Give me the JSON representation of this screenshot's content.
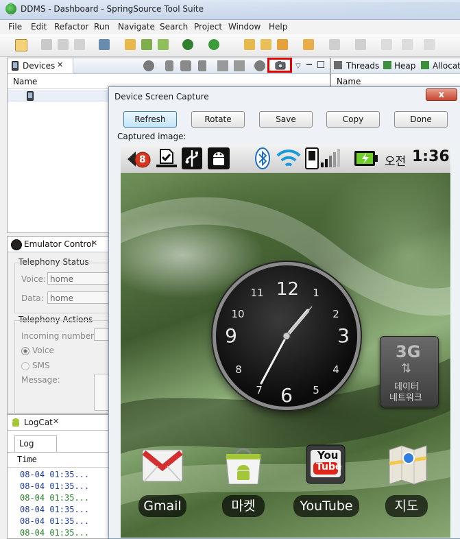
{
  "window": {
    "title": "DDMS - Dashboard - SpringSource Tool Suite"
  },
  "menu": [
    "File",
    "Edit",
    "Refactor",
    "Run",
    "Navigate",
    "Search",
    "Project",
    "Window",
    "Help"
  ],
  "devices": {
    "tab_label": "Devices",
    "tab_close": "✕",
    "name_header": "Name"
  },
  "right_panel": {
    "tabs": [
      "Threads",
      "Heap",
      "Allocatio"
    ],
    "name_header": "Name"
  },
  "emulator": {
    "tab_label": "Emulator Control",
    "tab_close": "✕",
    "telephony_status": "Telephony Status",
    "voice_label": "Voice:",
    "voice_value": "home",
    "data_label": "Data:",
    "data_value": "home",
    "telephony_actions": "Telephony Actions",
    "incoming_label": "Incoming number:",
    "radio_voice": "Voice",
    "radio_sms": "SMS",
    "message_label": "Message:"
  },
  "logcat": {
    "tab_label": "LogCat",
    "tab_close": "✕",
    "subtab": "Log",
    "time_header": "Time",
    "rows": [
      {
        "text": "08-04 01:35...",
        "color": "#1f3fa0"
      },
      {
        "text": "08-04 01:35...",
        "color": "#1f3fa0"
      },
      {
        "text": "08-04 01:35...",
        "color": "#2a7f2a"
      },
      {
        "text": "08-04 01:35...",
        "color": "#1f3fa0"
      },
      {
        "text": "08-04 01:35...",
        "color": "#1f3fa0"
      },
      {
        "text": "08-04 01:35...",
        "color": "#2a7f2a"
      }
    ]
  },
  "dialog": {
    "title": "Device Screen Capture",
    "close": "x",
    "buttons": {
      "refresh": "Refresh",
      "rotate": "Rotate",
      "save": "Save",
      "copy": "Copy",
      "done": "Done"
    },
    "captured_label": "Captured image:"
  },
  "phone": {
    "notification_count": "8",
    "ampm": "오전",
    "time": "1:36",
    "clock_numbers": [
      "12",
      "1",
      "2",
      "3",
      "4",
      "5",
      "6",
      "7",
      "8",
      "9",
      "10",
      "11"
    ],
    "widget": {
      "title": "3G",
      "line1": "데이터",
      "line2": "네트워크"
    },
    "apps": [
      "Gmail",
      "마켓",
      "YouTube",
      "지도"
    ],
    "youtube_you": "You",
    "youtube_tube": "Tube"
  },
  "colors": {
    "highlight": "#e00000",
    "dialog_close": "#c6462f",
    "android_green": "#a4c639"
  }
}
